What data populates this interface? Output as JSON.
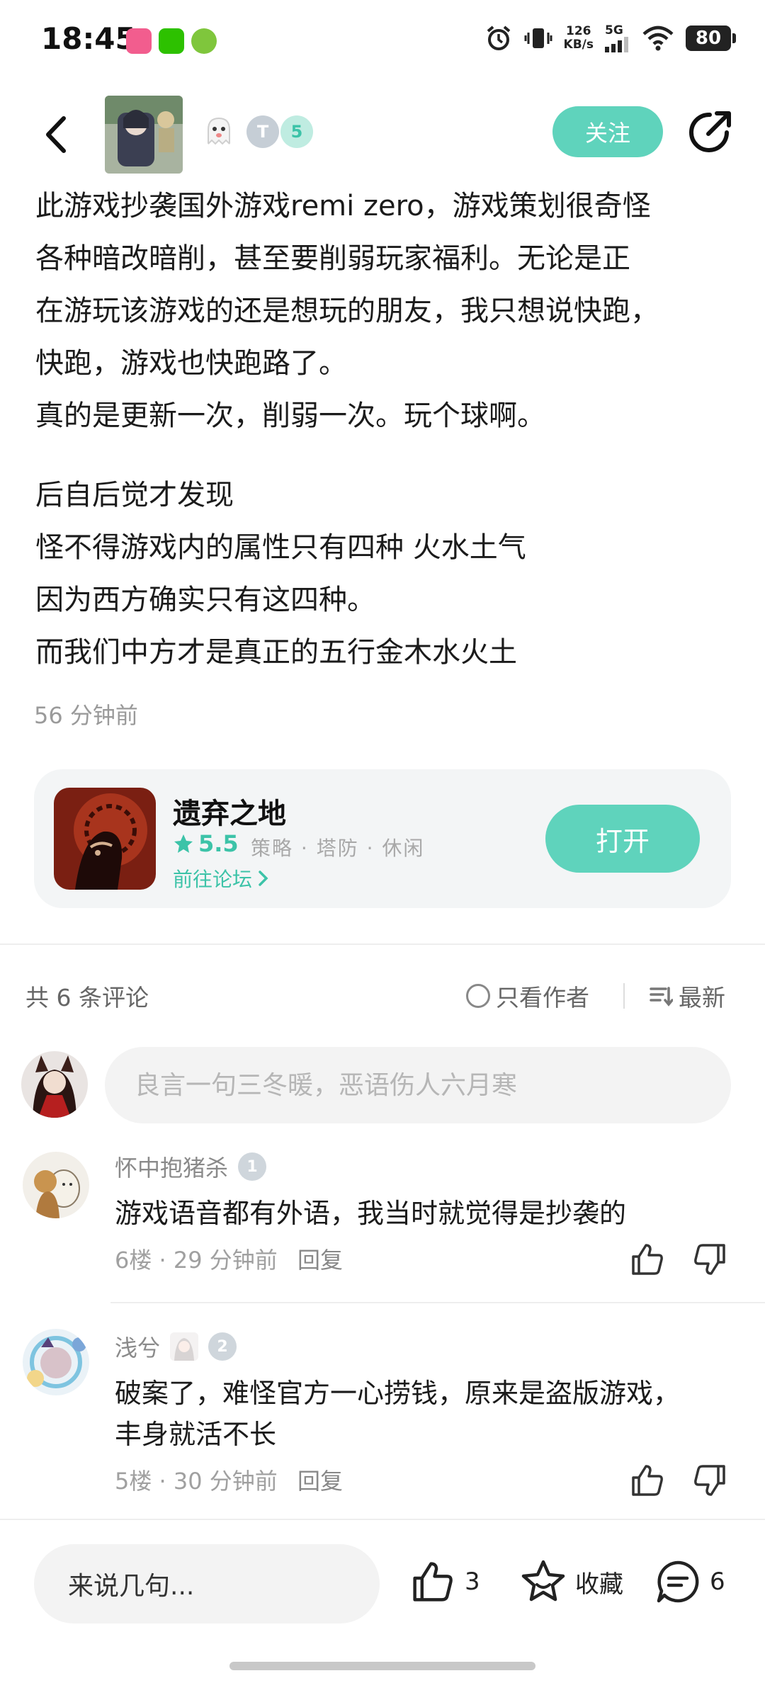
{
  "status_bar": {
    "time": "18:45",
    "net_speed": "126",
    "net_unit": "KB/s",
    "network": "5G",
    "battery": "80"
  },
  "header": {
    "follow_label": "关注"
  },
  "post": {
    "lines": [
      "此游戏抄袭国外游戏remi zero，游戏策划很奇怪",
      "各种暗改暗削，甚至要削弱玩家福利。无论是正",
      "在游玩该游戏的还是想玩的朋友，我只想说快跑，",
      "快跑，游戏也快跑路了。",
      "真的是更新一次，削弱一次。玩个球啊。",
      "后自后觉才发现",
      "怪不得游戏内的属性只有四种 火水土气",
      "因为西方确实只有这四种。",
      "而我们中方才是真正的五行金木水火土"
    ],
    "time": "56 分钟前"
  },
  "game_card": {
    "title": "遗弃之地",
    "rating": "5.5",
    "tags": "策略 · 塔防 · 休闲",
    "forum_link": "前往论坛",
    "open_label": "打开"
  },
  "comments_header": {
    "count": "共 6 条评论",
    "only_author": "只看作者",
    "sort": "最新"
  },
  "comment_input": {
    "placeholder": "良言一句三冬暖，恶语伤人六月寒"
  },
  "comments": [
    {
      "user": "怀中抱猪杀",
      "level": "1",
      "lines": [
        "游戏语音都有外语，我当时就觉得是抄袭的"
      ],
      "floor": "6楼",
      "time": "29 分钟前",
      "reply": "回复"
    },
    {
      "user": "浅兮",
      "level": "2",
      "lines": [
        "破案了，难怪官方一心捞钱，原来是盗版游戏，",
        "丰身就活不长"
      ],
      "floor": "5楼",
      "time": "30 分钟前",
      "reply": "回复"
    }
  ],
  "bottom_bar": {
    "input_placeholder": "来说几句...",
    "likes": "3",
    "favorite": "收藏",
    "comments": "6"
  },
  "colors": {
    "accent": "#5fd3bc",
    "accent_text": "#3cc3a8",
    "text_secondary": "#9a9a9a"
  }
}
